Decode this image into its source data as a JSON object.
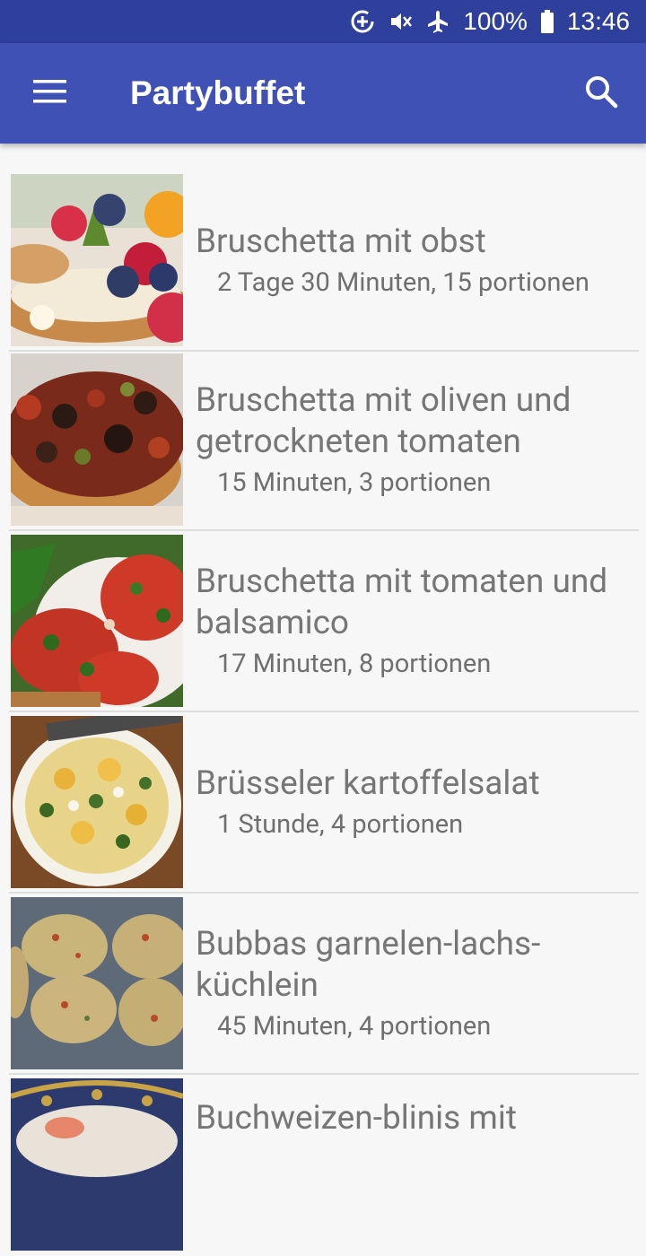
{
  "status": {
    "battery": "100%",
    "time": "13:46",
    "icons": [
      "data-saver-icon",
      "mute-icon",
      "airplane-mode-icon",
      "battery-icon"
    ]
  },
  "app_bar": {
    "title": "Partybuffet",
    "menu_icon": "hamburger-menu-icon",
    "search_icon": "search-icon"
  },
  "recipes": [
    {
      "title": "Bruschetta mit obst",
      "meta": "2 Tage 30 Minuten, 15 portionen",
      "image": "fruit-bruschetta"
    },
    {
      "title": "Bruschetta mit oliven und getrockneten tomaten",
      "meta": "15 Minuten, 3 portionen",
      "image": "olive-bruschetta"
    },
    {
      "title": "Bruschetta mit tomaten und balsamico",
      "meta": "17 Minuten, 8 portionen",
      "image": "tomato-bruschetta"
    },
    {
      "title": "Brüsseler kartoffelsalat",
      "meta": "1 Stunde, 4 portionen",
      "image": "potato-salad"
    },
    {
      "title": "Bubbas garnelen-lachs-küchlein",
      "meta": "45 Minuten, 4 portionen",
      "image": "shrimp-salmon-cakes"
    },
    {
      "title": "Buchweizen-blinis mit",
      "meta": "",
      "image": "buckwheat-blinis"
    }
  ]
}
